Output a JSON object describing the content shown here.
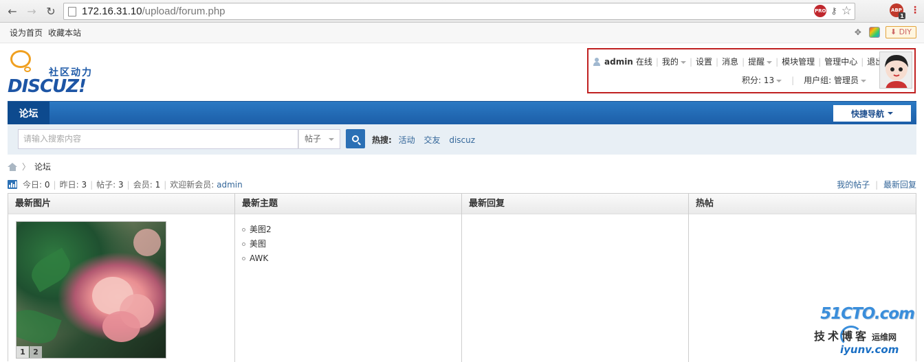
{
  "browser": {
    "url_host": "172.16.31.10",
    "url_path": "/upload/forum.php",
    "ext_pro_label": "PRO",
    "ext_abp_label": "ABP",
    "ext_abp_count": "1"
  },
  "topbar": {
    "set_home": "设为首页",
    "bookmark": "收藏本站",
    "diy_label": "DIY"
  },
  "header": {
    "slogan": "社区动力",
    "brand": "DISCUZ!"
  },
  "usermenu": {
    "username": "admin",
    "status": "在线",
    "items": [
      "我的",
      "设置",
      "消息",
      "提醒",
      "模块管理",
      "管理中心",
      "退出"
    ],
    "credits_label": "积分: 13",
    "usergroup_label": "用户组: 管理员"
  },
  "nav": {
    "forum_tab": "论坛",
    "quick_nav": "快捷导航"
  },
  "search": {
    "placeholder": "请输入搜索内容",
    "type": "帖子",
    "hot_label": "热搜:",
    "hot_terms": [
      "活动",
      "交友",
      "discuz"
    ]
  },
  "breadcrumb": {
    "current": "论坛"
  },
  "stats": {
    "today_label": "今日:",
    "today": "0",
    "yesterday_label": "昨日:",
    "yesterday": "3",
    "posts_label": "帖子:",
    "posts": "3",
    "members_label": "会员:",
    "members": "1",
    "welcome_label": "欢迎新会员:",
    "newest_member": "admin",
    "my_posts": "我的帖子",
    "latest_replies": "最新回复"
  },
  "grid": {
    "columns": [
      "最新图片",
      "最新主题",
      "最新回复",
      "热帖"
    ],
    "latest_topics": [
      "美图2",
      "美图",
      "AWK"
    ],
    "pager": [
      "1",
      "2"
    ]
  },
  "watermark": {
    "site": "51CTO.com",
    "line2": "技术博客",
    "line2b": "运维网",
    "line3": "iyunv.com"
  }
}
